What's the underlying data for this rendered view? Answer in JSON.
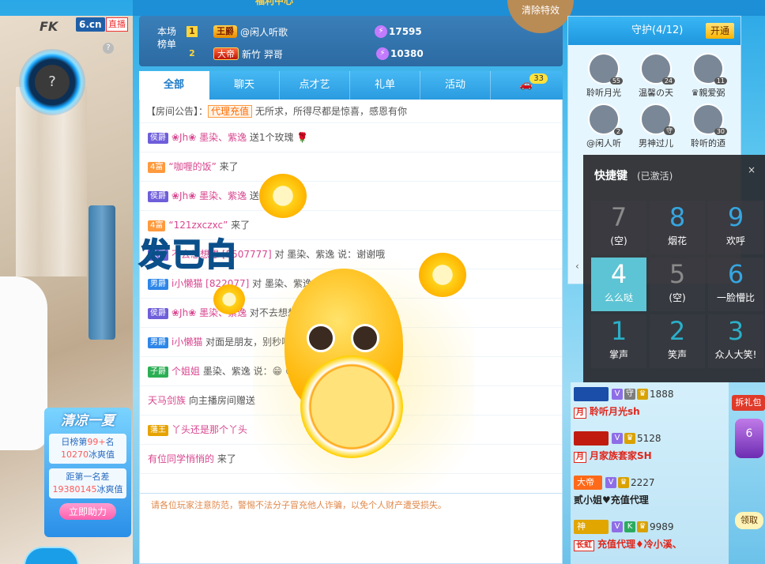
{
  "left_stream": {
    "logo": "FK",
    "site": "6.cn",
    "live_label": "直播",
    "help": "?",
    "avatar_placeholder": "?",
    "promo": {
      "title": "清凉一夏",
      "rank_line1_prefix": "日榜第",
      "rank_value": "99+",
      "rank_line1_suffix": "名",
      "score_value": "10270",
      "score_unit": "冰爽值",
      "gap_prefix": "距第一名差",
      "gap_value": "19380145",
      "gap_unit": "冰爽值",
      "button": "立即助力"
    }
  },
  "top_banner_text": "福利中心",
  "clear_effects": "清除特效",
  "rank_board": {
    "label": "本场榜单",
    "rows": [
      {
        "num": "1",
        "badge": "王爵",
        "name": "@闲人听歌",
        "score": "17595"
      },
      {
        "num": "2",
        "badge": "大帝",
        "name": "新竹 羿哥",
        "score": "10380"
      }
    ]
  },
  "tabs": [
    {
      "label": "全部",
      "active": true
    },
    {
      "label": "聊天",
      "active": false
    },
    {
      "label": "点才艺",
      "active": false
    },
    {
      "label": "礼单",
      "active": false
    },
    {
      "label": "活动",
      "active": false
    }
  ],
  "car_count": "33",
  "announcement": {
    "prefix": "【房间公告】：",
    "tag": "代理充值",
    "text": "无所求，所得尽都是惊喜，感恩有你"
  },
  "messages": [
    {
      "badge": "侯爵",
      "badge_class": "lv-hj",
      "nick": "❀Jh❀ 墨染、紫逸",
      "text": "送1个玫瑰 🌹"
    },
    {
      "badge": "4富",
      "badge_class": "lv-fu",
      "nick": "“咖喱的饭”",
      "text": "来了"
    },
    {
      "badge": "侯爵",
      "badge_class": "lv-hj",
      "nick": "❀Jh❀ 墨染、紫逸",
      "text": "送1个玫瑰 🌹"
    },
    {
      "badge": "4富",
      "badge_class": "lv-fu",
      "nick": "“121zxczxc”",
      "text": "来了"
    },
    {
      "badge": "侯爵",
      "badge_class": "lv-hj",
      "nick": "不去想想想 [5507777]",
      "text": "对 墨染、紫逸 说：谢谢哦"
    },
    {
      "badge": "男爵",
      "badge_class": "lv-nj",
      "nick": "i小懒猫 [822077]",
      "text": "对 墨染、紫逸 说：👍"
    },
    {
      "badge": "侯爵",
      "badge_class": "lv-hj",
      "nick": "❀Jh❀ 墨染、紫逸",
      "text": "对不去想想想 [5507777] 说：😊"
    },
    {
      "badge": "男爵",
      "badge_class": "lv-nj",
      "nick": "i小懒猫",
      "text": "对面是朋友，别秒啊👌"
    },
    {
      "badge": "子爵",
      "badge_class": "lv-zj",
      "nick": "个姐姐",
      "text": "墨染、紫逸 说：😁 😁"
    },
    {
      "badge": "",
      "badge_class": "",
      "nick": "天马剑族",
      "text": "向主播房间赠送"
    },
    {
      "badge": "藩王",
      "badge_class": "lv-pw",
      "nick": "丫头还是那个丫头",
      "text": ""
    },
    {
      "badge": "",
      "badge_class": "",
      "nick": "有位同学悄悄的",
      "text": "来了"
    }
  ],
  "effect_text": "发已白",
  "notice": "请各位玩家注意防范，警惕不法分子冒充他人诈骗，以免个人财产遭受损失。",
  "guard": {
    "title": "守护(4/12)",
    "open_label": "开通",
    "members": [
      {
        "name": "聆听月光",
        "tag": "55"
      },
      {
        "name": "温馨の天",
        "tag": "24"
      },
      {
        "name": "♛親爱弼",
        "tag": "11"
      },
      {
        "name": "@闲人听",
        "tag": "2"
      },
      {
        "name": "男神过儿",
        "tag": "守"
      },
      {
        "name": "聆听的迺",
        "tag": "30"
      }
    ]
  },
  "quick_keys": {
    "title": "快捷键",
    "status": "(已激活)",
    "close": "×",
    "keys": [
      {
        "num": "7",
        "label": "(空)",
        "style": ""
      },
      {
        "num": "8",
        "label": "烟花",
        "style": "c1"
      },
      {
        "num": "9",
        "label": "欢呼",
        "style": "c1"
      },
      {
        "num": "4",
        "label": "么么哒",
        "style": "sel"
      },
      {
        "num": "5",
        "label": "(空)",
        "style": ""
      },
      {
        "num": "6",
        "label": "一脸懵比",
        "style": "c1"
      },
      {
        "num": "1",
        "label": "掌声",
        "style": "c2"
      },
      {
        "num": "2",
        "label": "笑声",
        "style": "c2"
      },
      {
        "num": "3",
        "label": "众人大笑!",
        "style": "c2"
      }
    ]
  },
  "rank_list": [
    {
      "tag": "",
      "mini": [
        "V",
        "守"
      ],
      "score": "1888",
      "sub": "月",
      "name": "聆听月光sh"
    },
    {
      "tag": "",
      "mini": [
        "V"
      ],
      "score": "5128",
      "sub": "月",
      "name": "月家族套家SH"
    },
    {
      "tag": "大帝",
      "mini": [
        "V"
      ],
      "score": "2227",
      "sub": "",
      "name": "贰小姐♥充值代理"
    },
    {
      "tag": "神",
      "mini": [
        "V",
        "K"
      ],
      "score": "9989",
      "sub": "长虹",
      "name": "充值代理♦冷小溪、"
    }
  ],
  "right_side": {
    "gift_label": "拆礼包",
    "badge_label": "6",
    "claim_label": "领取"
  }
}
